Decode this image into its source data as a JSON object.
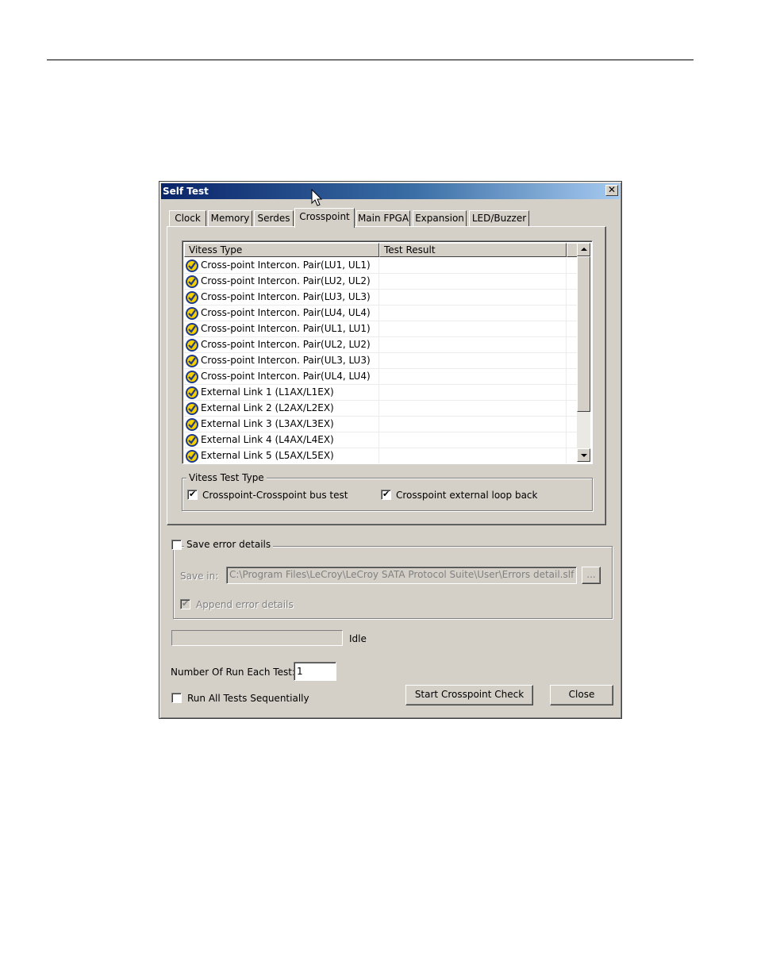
{
  "window": {
    "title": "Self Test",
    "close_glyph": "✕"
  },
  "tabs": [
    {
      "label": "Clock"
    },
    {
      "label": "Memory"
    },
    {
      "label": "Serdes"
    },
    {
      "label": "Crosspoint",
      "active": true
    },
    {
      "label": "Main FPGA"
    },
    {
      "label": "Expansion"
    },
    {
      "label": "LED/Buzzer"
    }
  ],
  "list": {
    "columns": [
      "Vitess Type",
      "Test Result"
    ],
    "rows": [
      {
        "type": "Cross-point Intercon. Pair(LU1, UL1)",
        "result": "",
        "checked": true
      },
      {
        "type": "Cross-point Intercon. Pair(LU2, UL2)",
        "result": "",
        "checked": true
      },
      {
        "type": "Cross-point Intercon. Pair(LU3, UL3)",
        "result": "",
        "checked": true
      },
      {
        "type": "Cross-point Intercon. Pair(LU4, UL4)",
        "result": "",
        "checked": true
      },
      {
        "type": "Cross-point Intercon. Pair(UL1, LU1)",
        "result": "",
        "checked": true
      },
      {
        "type": "Cross-point Intercon. Pair(UL2, LU2)",
        "result": "",
        "checked": true
      },
      {
        "type": "Cross-point Intercon. Pair(UL3, LU3)",
        "result": "",
        "checked": true
      },
      {
        "type": "Cross-point Intercon. Pair(UL4, LU4)",
        "result": "",
        "checked": true
      },
      {
        "type": "External Link 1 (L1AX/L1EX)",
        "result": "",
        "checked": true
      },
      {
        "type": "External Link 2 (L2AX/L2EX)",
        "result": "",
        "checked": true
      },
      {
        "type": "External Link 3 (L3AX/L3EX)",
        "result": "",
        "checked": true
      },
      {
        "type": "External Link 4 (L4AX/L4EX)",
        "result": "",
        "checked": true
      },
      {
        "type": "External Link 5 (L5AX/L5EX)",
        "result": "",
        "checked": true
      }
    ]
  },
  "vitess_test_type": {
    "label": "Vitess Test Type",
    "bus_test": {
      "label": "Crosspoint-Crosspoint bus test",
      "checked": true
    },
    "loop_back": {
      "label": "Crosspoint external loop back",
      "checked": true
    }
  },
  "save_error": {
    "label": "Save error details",
    "checked": false,
    "save_in_label": "Save in:",
    "path": "C:\\Program Files\\LeCroy\\LeCroy SATA Protocol Suite\\User\\Errors detail.slf",
    "browse_label": "...",
    "append_label": "Append error details",
    "append_checked": true
  },
  "status": {
    "text": "Idle",
    "progress": 0
  },
  "runs": {
    "label": "Number Of Run Each Test:",
    "value": "1"
  },
  "run_all": {
    "label": "Run All Tests Sequentially",
    "checked": false
  },
  "buttons": {
    "start": "Start Crosspoint Check",
    "close": "Close"
  },
  "check_glyph": "✔",
  "colors": {
    "title_start": "#0a246a",
    "title_end": "#a6caf0",
    "face": "#d4d0c8",
    "icon_ring": "#1f3a8c",
    "icon_fill": "#f4d000"
  }
}
